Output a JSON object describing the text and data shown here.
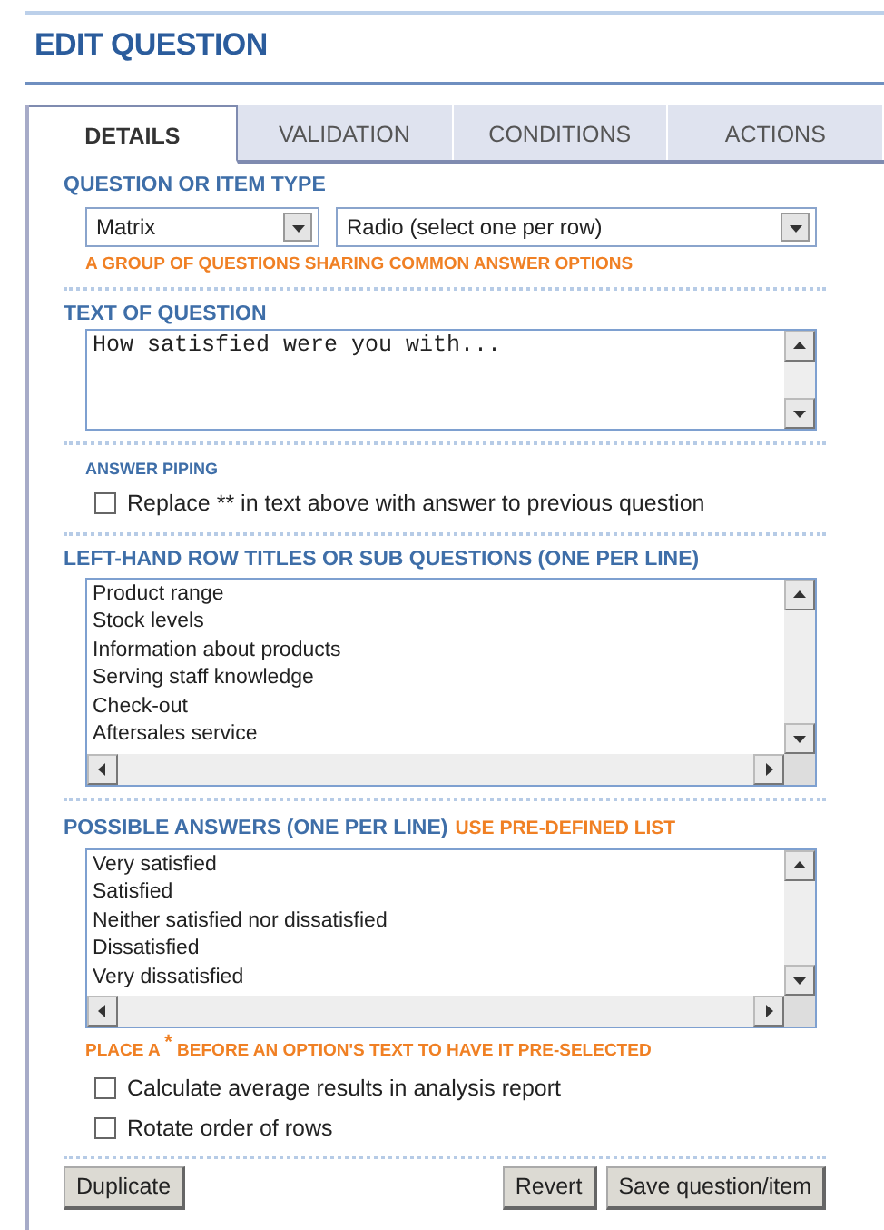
{
  "title": "EDIT QUESTION",
  "tabs": [
    {
      "label": "DETAILS",
      "selected": true
    },
    {
      "label": "VALIDATION",
      "selected": false
    },
    {
      "label": "CONDITIONS",
      "selected": false
    },
    {
      "label": "ACTIONS",
      "selected": false
    }
  ],
  "item_type": {
    "label": "QUESTION OR ITEM TYPE",
    "type_select": {
      "value": "Matrix"
    },
    "subtype_select": {
      "value": "Radio (select one per row)"
    },
    "hint": "A GROUP OF QUESTIONS SHARING COMMON ANSWER OPTIONS"
  },
  "question_text": {
    "label": "TEXT OF QUESTION",
    "value": "How satisfied were you with..."
  },
  "answer_piping": {
    "label": "ANSWER PIPING",
    "option": {
      "label": "Replace ** in text above with answer to previous question",
      "checked": false
    }
  },
  "row_titles": {
    "label": "LEFT-HAND ROW TITLES OR SUB QUESTIONS (ONE PER LINE)",
    "lines": [
      "Product range",
      "Stock levels",
      "Information about products",
      "Serving staff knowledge",
      "Check-out",
      "Aftersales service"
    ]
  },
  "possible_answers": {
    "label": "POSSIBLE ANSWERS (ONE PER LINE)",
    "link": "USE PRE-DEFINED LIST",
    "lines": [
      "Very satisfied",
      "Satisfied",
      "Neither satisfied nor dissatisfied",
      "Dissatisfied",
      "Very dissatisfied"
    ],
    "hint": "PLACE A $^{*}$ BEFORE AN OPTION'S TEXT TO HAVE IT PRE-SELECTED"
  },
  "options": [
    {
      "label": "Calculate average results in analysis report",
      "checked": false
    },
    {
      "label": "Rotate order of rows",
      "checked": false
    }
  ],
  "buttons_left": [
    "Duplicate"
  ],
  "buttons_right": [
    "Revert",
    "Save question/item"
  ]
}
